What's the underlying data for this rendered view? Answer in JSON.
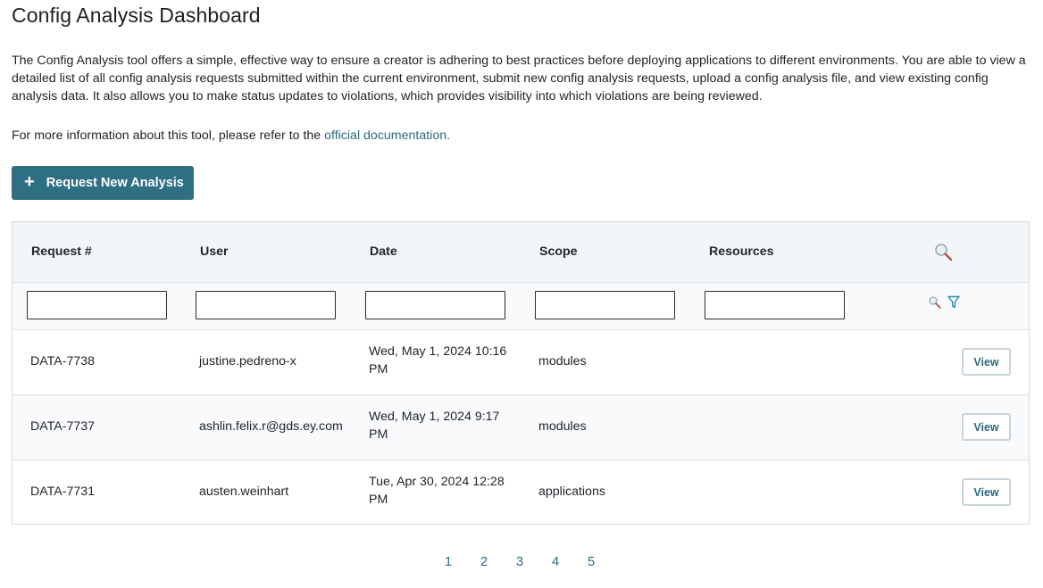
{
  "page": {
    "title": "Config Analysis Dashboard",
    "description": "The Config Analysis tool offers a simple, effective way to ensure a creator is adhering to best practices before deploying applications to different environments. You are able to view a detailed list of all config analysis requests submitted within the current environment, submit new config analysis requests, upload a config analysis file, and view existing config analysis data. It also allows you to make status updates to violations, which provides visibility into which violations are being reviewed.",
    "more_info_prefix": "For more information about this tool, please refer to the ",
    "doc_link": "official documentation."
  },
  "actions": {
    "request_new_analysis": "Request New Analysis"
  },
  "table": {
    "columns": [
      "Request #",
      "User",
      "Date",
      "Scope",
      "Resources"
    ],
    "rows": [
      {
        "request": "DATA-7738",
        "user": "justine.pedreno-x",
        "date": "Wed, May 1, 2024 10:16 PM",
        "scope": "modules",
        "resources": "",
        "action": "View"
      },
      {
        "request": "DATA-7737",
        "user": "ashlin.felix.r@gds.ey.com",
        "date": "Wed, May 1, 2024 9:17 PM",
        "scope": "modules",
        "resources": "",
        "action": "View"
      },
      {
        "request": "DATA-7731",
        "user": "austen.weinhart",
        "date": "Tue, Apr 30, 2024 12:28 PM",
        "scope": "applications",
        "resources": "",
        "action": "View"
      }
    ]
  },
  "pagination": {
    "pages": [
      "1",
      "2",
      "3",
      "4",
      "5"
    ]
  },
  "colors": {
    "accent": "#2e6f84",
    "link": "#2b6a80",
    "header_bg": "#f2f6f9"
  },
  "icons": {
    "header_search": "search-icon",
    "filter_search": "search-icon",
    "filter": "funnel-icon"
  }
}
